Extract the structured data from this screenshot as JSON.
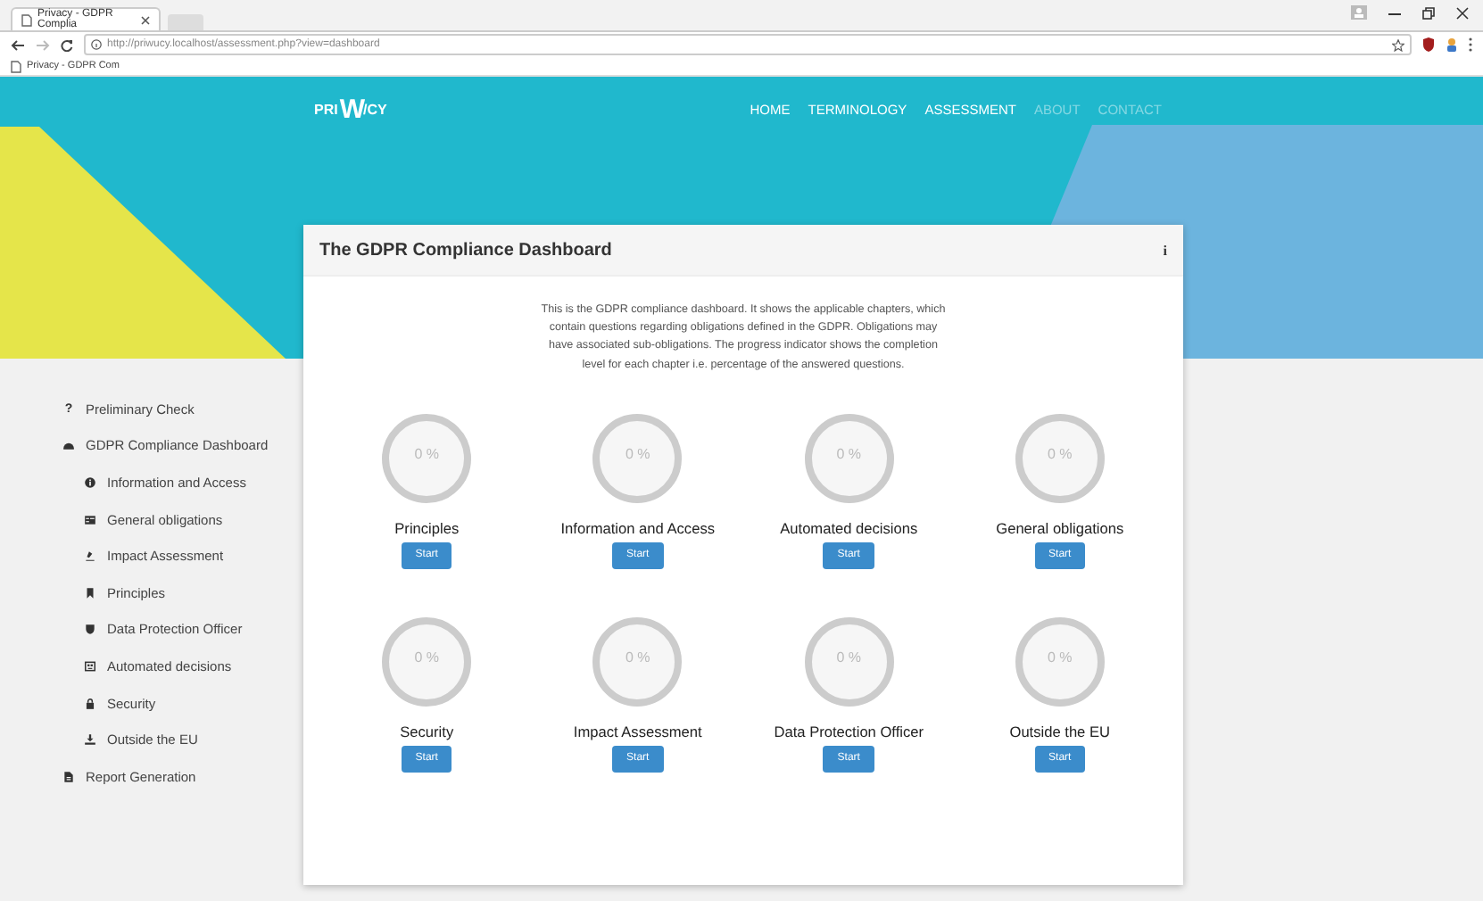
{
  "browser": {
    "tab": {
      "title": "Privacy - GDPR Complia"
    },
    "url": "http://priwucy.localhost/assessment.php?view=dashboard",
    "bookmark": "Privacy - GDPR Com"
  },
  "logo": {
    "prefix": "PRI",
    "mark": "W",
    "suffix": "/CY"
  },
  "nav": [
    {
      "label": "HOME",
      "disabled": false
    },
    {
      "label": "TERMINOLOGY",
      "disabled": false
    },
    {
      "label": "ASSESSMENT",
      "disabled": false
    },
    {
      "label": "ABOUT",
      "disabled": true
    },
    {
      "label": "CONTACT",
      "disabled": true
    }
  ],
  "sidebar": {
    "items": [
      {
        "label": "Preliminary Check",
        "glyph": "?"
      },
      {
        "label": "GDPR Compliance Dashboard",
        "children": [
          {
            "label": "Information and Access"
          },
          {
            "label": "General obligations"
          },
          {
            "label": "Impact Assessment"
          },
          {
            "label": "Principles"
          },
          {
            "label": "Data Protection Officer"
          },
          {
            "label": "Automated decisions"
          },
          {
            "label": "Security"
          },
          {
            "label": "Outside the EU"
          }
        ]
      },
      {
        "label": "Report Generation"
      }
    ]
  },
  "card": {
    "title": "The GDPR Compliance Dashboard",
    "info_glyph": "i",
    "description": "This is the GDPR compliance dashboard. It shows the applicable chapters, which contain questions regarding obligations defined in the GDPR. Obligations may have associated sub-obligations. The progress indicator shows the completion level for each chapter i.e. percentage of the answered questions.",
    "chapters": [
      {
        "name": "Principles",
        "percent": "0 %",
        "level": 0,
        "button": "Start"
      },
      {
        "name": "Information and Access",
        "percent": "0 %",
        "level": 0,
        "button": "Start"
      },
      {
        "name": "Automated decisions",
        "percent": "0 %",
        "level": 0,
        "button": "Start"
      },
      {
        "name": "General obligations",
        "percent": "0 %",
        "level": 0,
        "button": "Start"
      },
      {
        "name": "Security",
        "percent": "0 %",
        "level": 0,
        "button": "Start"
      },
      {
        "name": "Impact Assessment",
        "percent": "0 %",
        "level": 0,
        "button": "Start"
      },
      {
        "name": "Data Protection Officer",
        "percent": "0 %",
        "level": 0,
        "button": "Start"
      },
      {
        "name": "Outside the EU",
        "percent": "0 %",
        "level": 0,
        "button": "Start"
      }
    ]
  }
}
